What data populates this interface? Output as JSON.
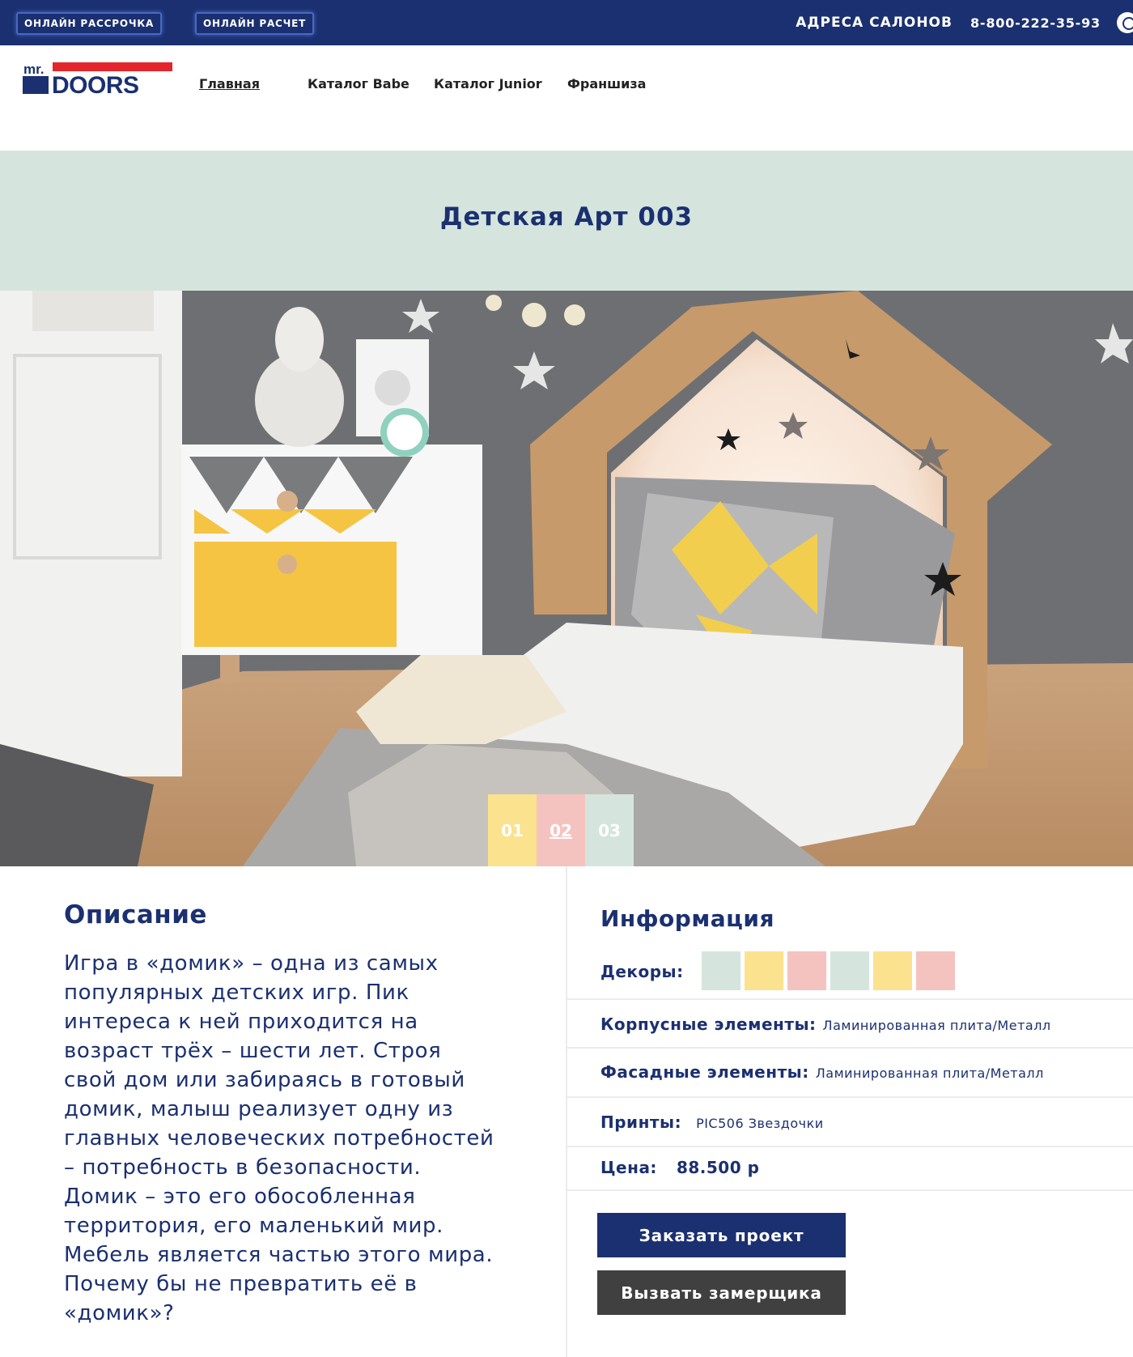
{
  "topbar": {
    "installment_label": "ОНЛАЙН РАССРОЧКА",
    "calc_label": "ОНЛАЙН РАСЧЕТ",
    "addresses_label": "АДРЕСА САЛОНОВ",
    "phone": "8-800-222-35-93",
    "whatsapp_icon": "whatsapp-icon"
  },
  "logo": {
    "mr": "mr.",
    "brand": "DOORS"
  },
  "nav": {
    "items": [
      "Главная",
      "Каталог Babe",
      "Каталог Junior",
      "Франшиза"
    ]
  },
  "page": {
    "title": "Детская Арт 003"
  },
  "hero": {
    "pager": [
      "01",
      "02",
      "03"
    ],
    "active_slide": "02",
    "pager_colors": [
      "#fbe28e",
      "#f5c3bf",
      "#d5e5dd"
    ]
  },
  "description": {
    "heading": "Описание",
    "text": "Игра в «домик» – одна из самых популярных детских игр. Пик интереса к ней приходится на возраст трёх – шести лет. Строя свой дом или забираясь в готовый домик, малыш реализует одну из главных человеческих потребностей – потребность в безопасности. Домик – это его обособленная территория, его маленький мир. Мебель является частью этого мира. Почему бы не превратить её в «домик»?"
  },
  "info": {
    "heading": "Информация",
    "decors_label": "Декоры:",
    "decor_colors": [
      "#d5e5dd",
      "#fbe28e",
      "#f5c3bf",
      "#d5e5dd",
      "#fbe28e",
      "#f5c3bf"
    ],
    "body_label": "Корпусные элементы:",
    "body_value": "Ламинированная плита/Металл",
    "facade_label": "Фасадные элементы:",
    "facade_value": "Ламинированная плита/Металл",
    "prints_label": "Принты:",
    "prints_value": "PIC506 Звездочки",
    "price_label": "Цена:",
    "price_value": "88.500 р"
  },
  "actions": {
    "order_label": "Заказать проект",
    "call_label": "Вызвать замерщика"
  },
  "colors": {
    "primary": "#1b3070",
    "accent_red": "#e3262b",
    "mint": "#d5e5dd",
    "yellow": "#fbe28e",
    "pink": "#f5c3bf",
    "dark_button": "#404040"
  }
}
